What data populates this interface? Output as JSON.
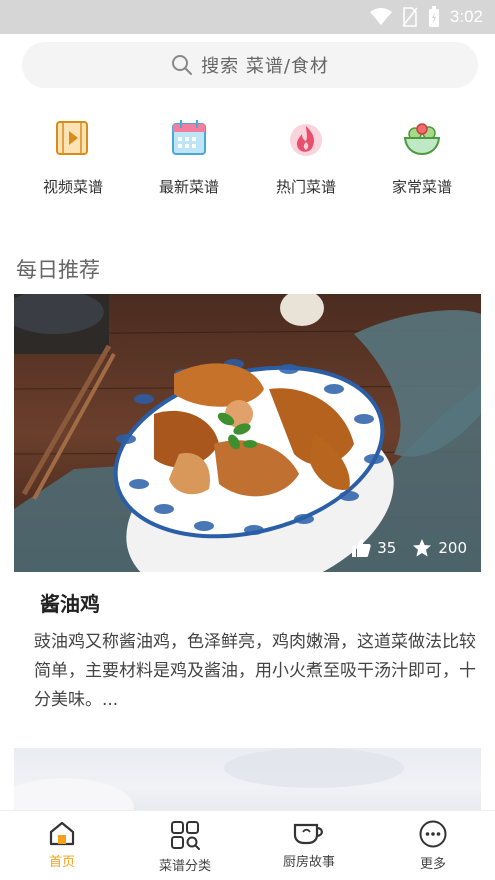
{
  "status": {
    "time": "3:02"
  },
  "search": {
    "placeholder": "搜索  菜谱/食材"
  },
  "categories": [
    {
      "label": "视频菜谱",
      "icon": "video-recipe-icon"
    },
    {
      "label": "最新菜谱",
      "icon": "calendar-icon"
    },
    {
      "label": "热门菜谱",
      "icon": "fire-icon"
    },
    {
      "label": "家常菜谱",
      "icon": "salad-bowl-icon"
    }
  ],
  "daily": {
    "title": "每日推荐",
    "recipe": {
      "name": "酱油鸡",
      "likes": "35",
      "favorites": "200",
      "description": "豉油鸡又称酱油鸡，色泽鲜亮，鸡肉嫩滑，这道菜做法比较简单，主要材料是鸡及酱油，用小火煮至吸干汤汁即可，十分美味。..."
    }
  },
  "tabs": [
    {
      "label": "首页",
      "icon": "home-icon",
      "active": true
    },
    {
      "label": "菜谱分类",
      "icon": "category-grid-icon",
      "active": false
    },
    {
      "label": "厨房故事",
      "icon": "cup-icon",
      "active": false
    },
    {
      "label": "更多",
      "icon": "more-icon",
      "active": false
    }
  ],
  "colors": {
    "accent": "#f3a11b",
    "statusbar": "#d6d6d6"
  }
}
